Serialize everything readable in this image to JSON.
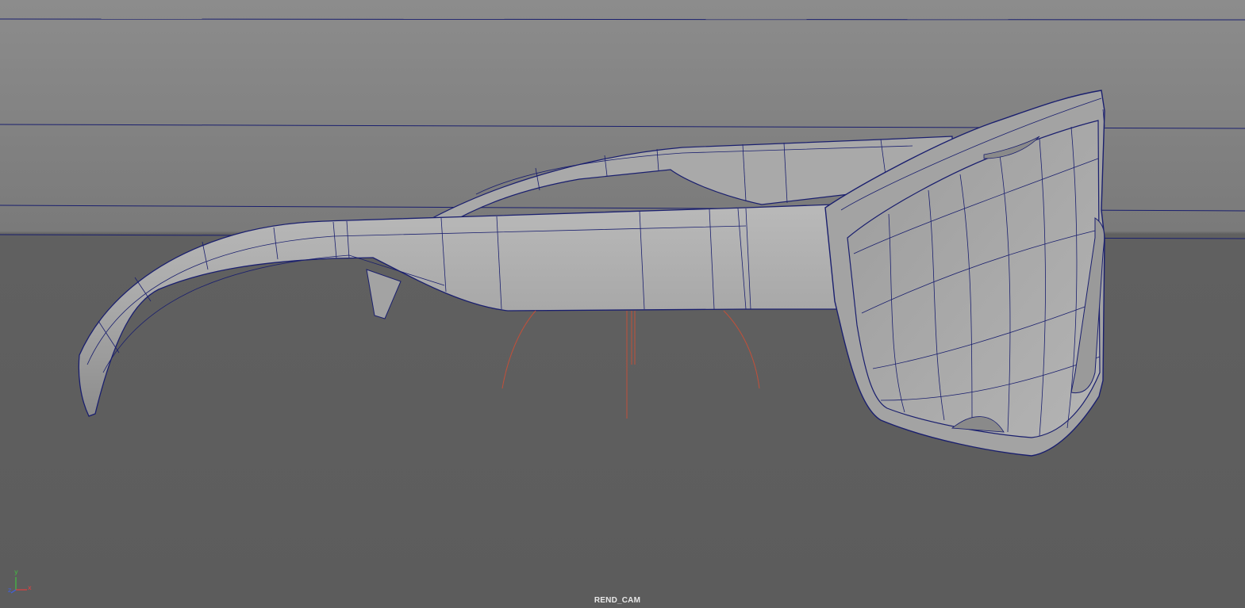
{
  "viewport": {
    "camera_name": "REND_CAM",
    "background_color": "#5e5e5e",
    "horizon_color": "#8a8a8a",
    "wire_color": "#1a1f6e",
    "pivot_color": "#c0503a"
  },
  "axis_gizmo": {
    "y_label": "y",
    "x_label": "x",
    "z_label": "z",
    "x_color": "#e04040",
    "y_color": "#40c040",
    "z_color": "#4060e0"
  },
  "model": {
    "object": "sunglasses-mesh",
    "shading": "wireframe-on-shaded"
  }
}
